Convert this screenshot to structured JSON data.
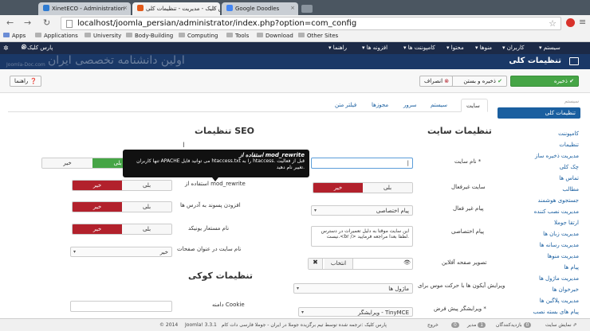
{
  "browser": {
    "tabs": [
      {
        "label": "XinetECO - Administration"
      },
      {
        "label": "پارس کلیک - مدیریت - تنظیمات کلی"
      },
      {
        "label": "Google Doodles"
      }
    ],
    "url": "localhost/joomla_persian/administrator/index.php?option=com_config",
    "url_prefix": "",
    "bookmarks": [
      "Apps",
      "Applications",
      "University",
      "Body-Building",
      "Computing",
      "Tools",
      "Download",
      "Other Sites"
    ]
  },
  "joomla": {
    "menu": [
      "سیستم",
      "کاربران",
      "منوها",
      "محتوا",
      "کامپوننت ها",
      "افزونه ها",
      "راهنما"
    ],
    "site_link": "پارس کلیک",
    "page_title": "تنظیمات کلی",
    "watermark": "اولین دانشنامه تخصصی ایران",
    "watermark_small": "Joomla-Doc.com"
  },
  "toolbar": {
    "save": "ذخیره",
    "save_close": "ذخیره و بستن",
    "cancel": "انصراف",
    "help": "راهنما"
  },
  "sidebar": {
    "heading": "سیستم",
    "active": "تنظیمات کلی",
    "section2": "کامپوننت",
    "items": [
      "تنظیمات",
      "مدیریت ذخیره ساز",
      "چک کلی",
      "تماس ها",
      "مطالب",
      "جستجوی هوشمند",
      "مدیریت نصب کننده",
      "ارتقا جوملا",
      "مدیریت زبان ها",
      "مدیریت رسانه ها",
      "مدیریت منوها",
      "پیام ها",
      "مدیریت ماژول ها",
      "خبرخوان ها",
      "مدیریت پلاگین ها",
      "پیام های بسته نصب"
    ]
  },
  "tabs": [
    "سایت",
    "سیستم",
    "سرور",
    "مجوزها",
    "فیلتر متن"
  ],
  "site_settings": {
    "heading": "تنظیمات سایت",
    "site_name_label": "نام سایت *",
    "site_name_value": "|",
    "offline_label": "سایت غیرفعال",
    "offline_yes": "بلی",
    "offline_no": "خیر",
    "offline_msg_label": "پیام غیر فعال",
    "offline_msg_value": "پیام اختصاصی",
    "custom_msg_label": "پیام اختصاصی",
    "custom_msg_value": "این سایت موقتا به دلیل تعمیرات در دسترس نیست.<br /> لطفا بعدا مراجعه فرمایید.",
    "offline_image_label": "تصویر صفحه آفلاین",
    "offline_image_select": "انتخاب",
    "mouseover_label": "ویرایش آیکون ها با حرکت موس برای",
    "mouseover_value": "ماژول ها",
    "editor_label": "ویرایشگر پیش فرض *",
    "editor_value": "ویرایشگر - TinyMCE"
  },
  "seo_settings": {
    "heading": "تنظیمات SEO",
    "sef_yes": "بلی",
    "sef_no": "خیر",
    "rewrite_label": "استفاده از mod_rewrite",
    "rewrite_yes": "بلی",
    "rewrite_no": "خیر",
    "suffix_label": "افزودن پسوند به آدرس ها",
    "suffix_yes": "بلی",
    "suffix_no": "خیر",
    "unicode_label": "نام مستعار یونیکد",
    "unicode_yes": "بلی",
    "unicode_no": "خیر",
    "sitename_title_label": "نام سایت در عنوان صفحات",
    "sitename_title_value": "خیر"
  },
  "tooltip": {
    "title": "استفاده از mod_rewrite",
    "body": "تنها کاربران APACHE می توانید فایل htaccess.txt را به htaccess. قبل از فعالیت تغییر نام دهید."
  },
  "cookie": {
    "heading": "تنظیمات کوکی",
    "domain_label": "دامنه Cookie"
  },
  "statusbar": {
    "view_site": "نمایش سایت",
    "visitors_label": "بازدیدکنندگان",
    "visitors_count": "0",
    "admin_label": "مدیر",
    "admin_count": "1",
    "messages_count": "0",
    "logout": "خروج",
    "footer": "پارس کلیک :ترجمه شده توسط تیم برگزیده جوملا در ایران - جوملا فارسی دات کام",
    "version": "Joomla! 3.3.1",
    "copyright": "© 2014"
  }
}
